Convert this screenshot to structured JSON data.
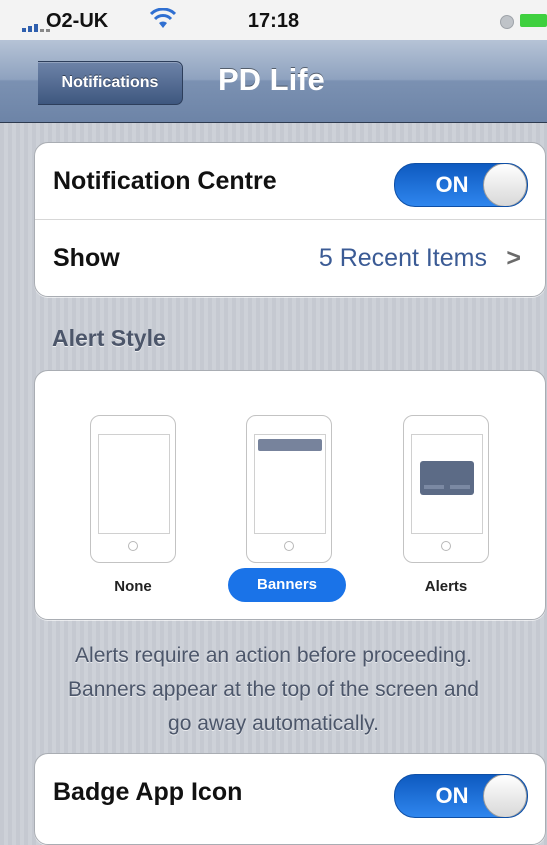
{
  "status_bar": {
    "carrier": "O2-UK",
    "time": "17:18",
    "signal_icon": "signal-bars-icon",
    "wifi_icon": "wifi-icon",
    "battery_icon": "battery-icon"
  },
  "nav": {
    "back_label": "Notifications",
    "title": "PD Life"
  },
  "notification_centre": {
    "label": "Notification Centre",
    "toggle_text": "ON",
    "enabled": true
  },
  "show": {
    "label": "Show",
    "value": "5 Recent Items",
    "chevron": ">"
  },
  "alert_style": {
    "header": "Alert Style",
    "options": [
      {
        "label": "None",
        "selected": false
      },
      {
        "label": "Banners",
        "selected": true
      },
      {
        "label": "Alerts",
        "selected": false
      }
    ],
    "selected_color": "#1a73e8"
  },
  "footer": {
    "line1": "Alerts require an action before proceeding.",
    "line2": "Banners appear at the top of the screen and",
    "line3": "go away automatically."
  },
  "badge_app_icon": {
    "label": "Badge App Icon",
    "toggle_text": "ON",
    "enabled": true
  },
  "colors": {
    "toggle_blue": "#2f86ee",
    "value_blue": "#3b5b95",
    "nav_bar": "#7b91b2"
  }
}
